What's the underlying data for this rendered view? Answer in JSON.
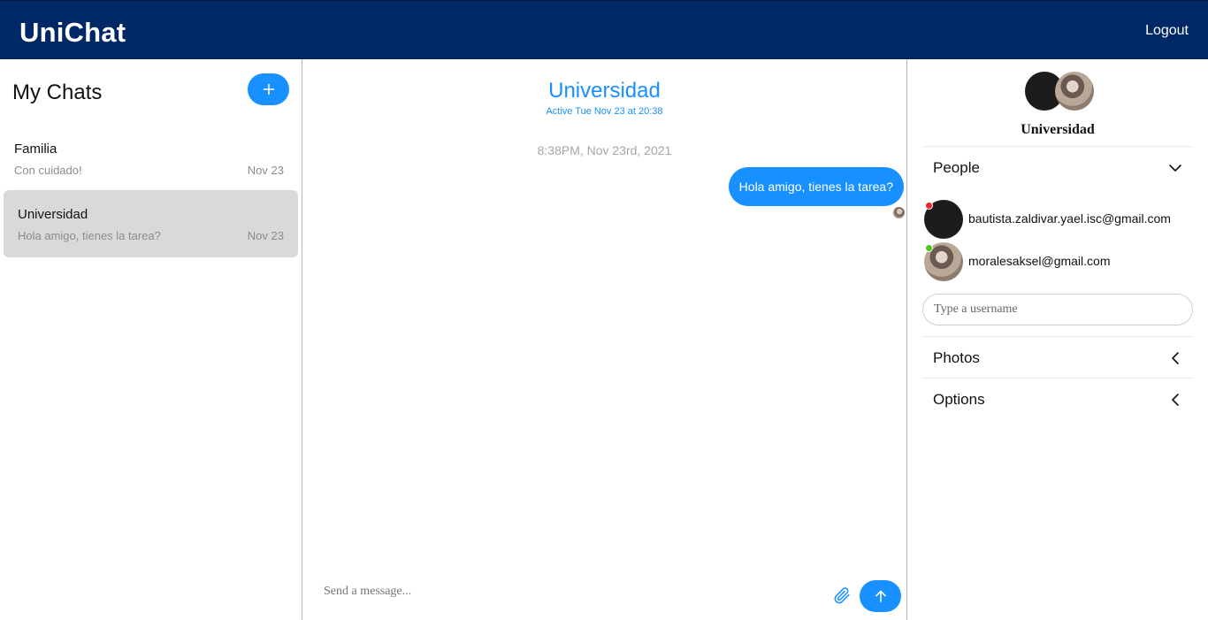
{
  "app": {
    "brand": "UniChat",
    "logout_label": "Logout"
  },
  "sidebar": {
    "title": "My Chats",
    "chats": [
      {
        "name": "Familia",
        "preview": "Con cuidado!",
        "date": "Nov 23",
        "active": false
      },
      {
        "name": "Universidad",
        "preview": "Hola amigo, tienes la tarea?",
        "date": "Nov 23",
        "active": true
      }
    ]
  },
  "conversation": {
    "title": "Universidad",
    "subtitle": "Active Tue Nov 23 at 20:38",
    "timestamp": "8:38PM, Nov 23rd, 2021",
    "messages": [
      {
        "text": "Hola amigo, tienes la tarea?",
        "from_me": true
      }
    ],
    "input_placeholder": "Send a message..."
  },
  "details": {
    "group_name": "Universidad",
    "sections": {
      "people": "People",
      "photos": "Photos",
      "options": "Options"
    },
    "people": [
      {
        "email": "bautista.zaldivar.yael.isc@gmail.com",
        "status": "offline"
      },
      {
        "email": "moralesaksel@gmail.com",
        "status": "online"
      }
    ],
    "username_placeholder": "Type a username"
  },
  "colors": {
    "topbar": "#002766",
    "accent": "#1890ff",
    "active_chat": "#d9d9d9",
    "status_offline": "#f5222d",
    "status_online": "#52c41a"
  }
}
